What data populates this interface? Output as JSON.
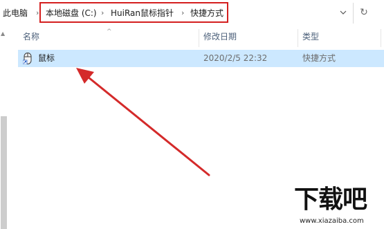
{
  "breadcrumb": {
    "root": "此电脑",
    "items": [
      "本地磁盘 (C:)",
      "HuiRan鼠标指针",
      "快捷方式"
    ]
  },
  "columns": {
    "name": "名称",
    "date_modified": "修改日期",
    "type": "类型"
  },
  "files": [
    {
      "name": "鼠标",
      "date_modified": "2020/2/5 22:32",
      "type": "快捷方式",
      "selected": true,
      "icon": "mouse-shortcut-icon"
    }
  ],
  "watermark": {
    "brand": "下载吧",
    "url": "www.xiazaiba.com"
  },
  "colors": {
    "highlight_border": "#d41f1f",
    "annotation_arrow": "#d42a2a",
    "selected_row": "#cce8ff",
    "column_header_text": "#4c607a"
  }
}
